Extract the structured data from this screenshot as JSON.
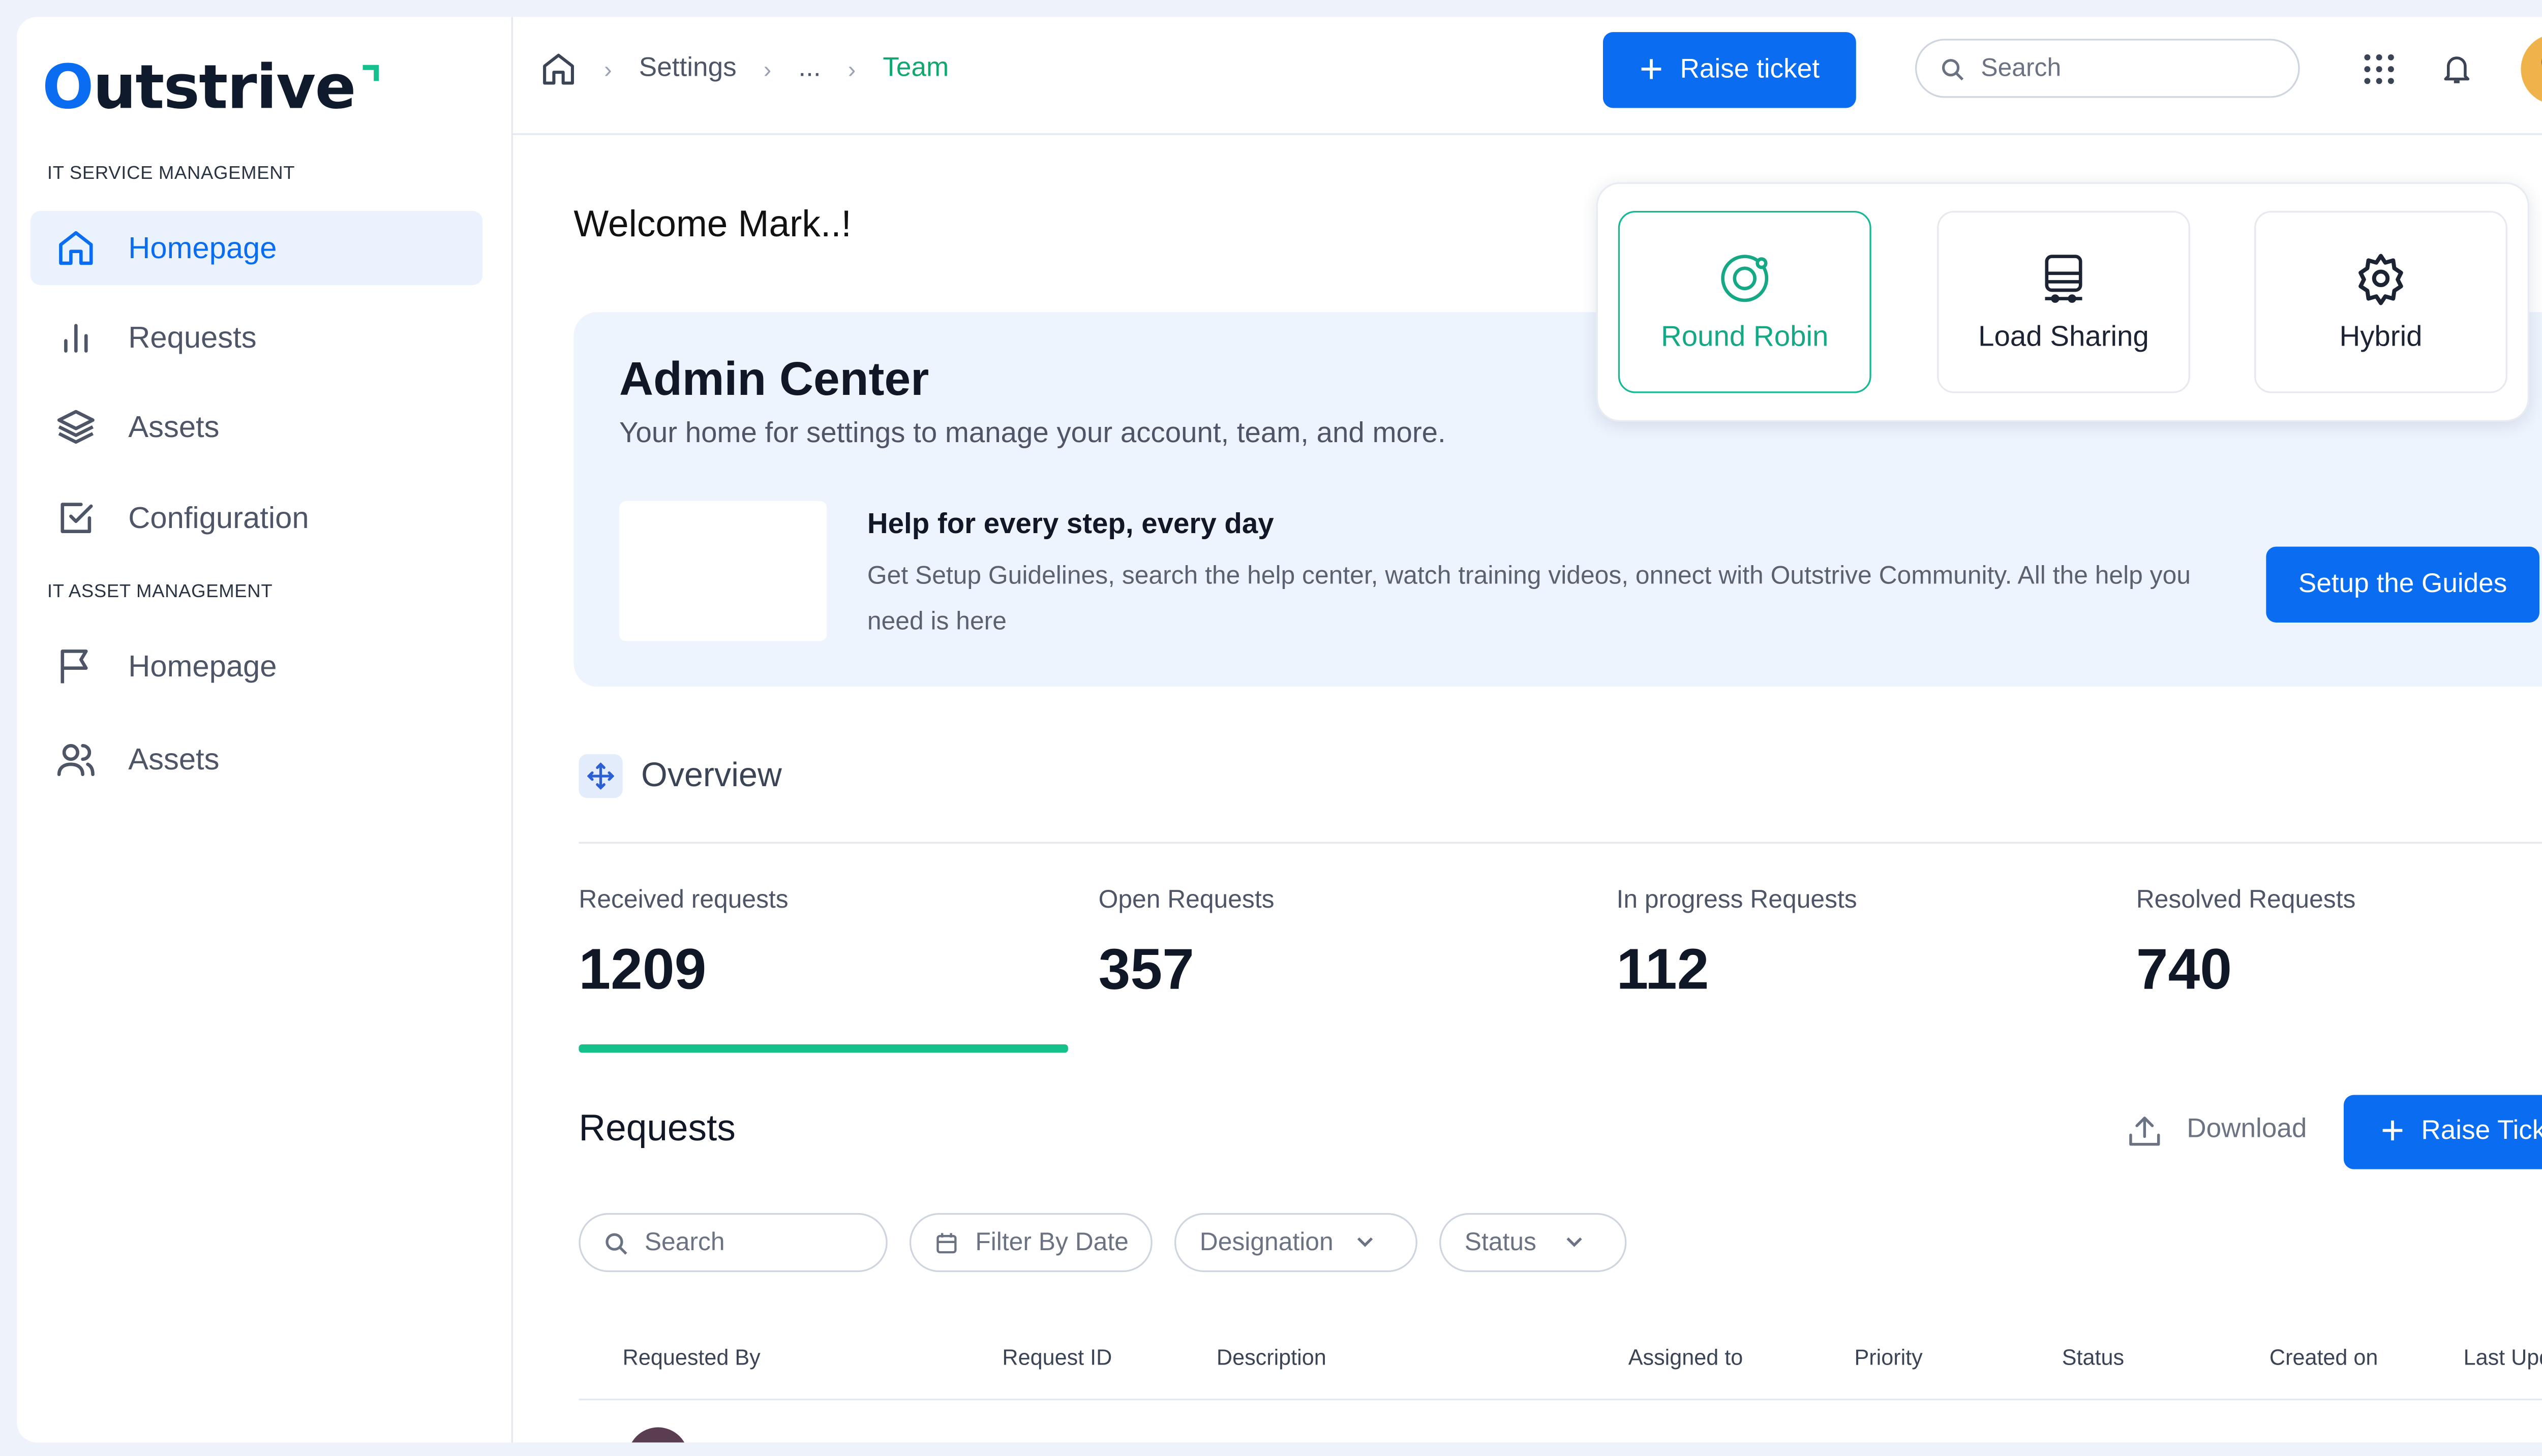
{
  "brand": {
    "name": "utstrive",
    "letter": "O"
  },
  "sidebar": {
    "sections": [
      {
        "label": "IT SERVICE MANAGEMENT"
      },
      {
        "label": "IT ASSET MANAGEMENT"
      }
    ],
    "items": [
      {
        "label": "Homepage",
        "icon": "home-icon",
        "active": true
      },
      {
        "label": "Requests",
        "icon": "bar-chart-icon"
      },
      {
        "label": "Assets",
        "icon": "layers-icon"
      },
      {
        "label": "Configuration",
        "icon": "check-square-icon"
      },
      {
        "label": "Homepage",
        "icon": "flag-icon"
      },
      {
        "label": "Assets",
        "icon": "users-icon"
      }
    ]
  },
  "header": {
    "breadcrumb": {
      "home_icon": "home-icon",
      "items": [
        "Settings",
        "...",
        "Team"
      ]
    },
    "raise_ticket_label": "Raise ticket",
    "search_placeholder": "Search",
    "icons": [
      "apps-grid-icon",
      "bell-icon",
      "avatar"
    ]
  },
  "main": {
    "welcome": "Welcome Mark..!",
    "admin": {
      "title": "Admin Center",
      "subtitle": "Your home for settings to manage your account, team, and more.",
      "help_title": "Help for every step, every day",
      "help_desc": "Get Setup Guidelines, search the help center, watch training videos, onnect with Outstrive Community.  All the help you need is here",
      "setup_button": "Setup the Guides"
    },
    "modes": [
      {
        "label": "Round Robin",
        "icon": "target-icon",
        "selected": true
      },
      {
        "label": "Load Sharing",
        "icon": "stack-icon",
        "selected": false
      },
      {
        "label": "Hybrid",
        "icon": "gear-icon",
        "selected": false
      }
    ],
    "overview": {
      "title": "Overview",
      "icon": "move-icon"
    },
    "stats": [
      {
        "label": "Received requests",
        "value": "1209"
      },
      {
        "label": "Open Requests",
        "value": "357"
      },
      {
        "label": "In progress Requests",
        "value": "112"
      },
      {
        "label": "Resolved Requests",
        "value": "740"
      }
    ],
    "requests": {
      "title": "Requests",
      "download_label": "Download",
      "raise_label": "Raise Ticket",
      "filters": {
        "search": "Search",
        "date": "Filter By Date",
        "designation": "Designation",
        "status": "Status"
      },
      "columns": [
        "Requested By",
        "Request ID",
        "Description",
        "Assigned to",
        "Priority",
        "Status",
        "Created on",
        "Last Updated"
      ]
    }
  },
  "colors": {
    "accent": "#0a6cf0",
    "success": "#15c08c",
    "admin_bg": "#edf4fd"
  }
}
